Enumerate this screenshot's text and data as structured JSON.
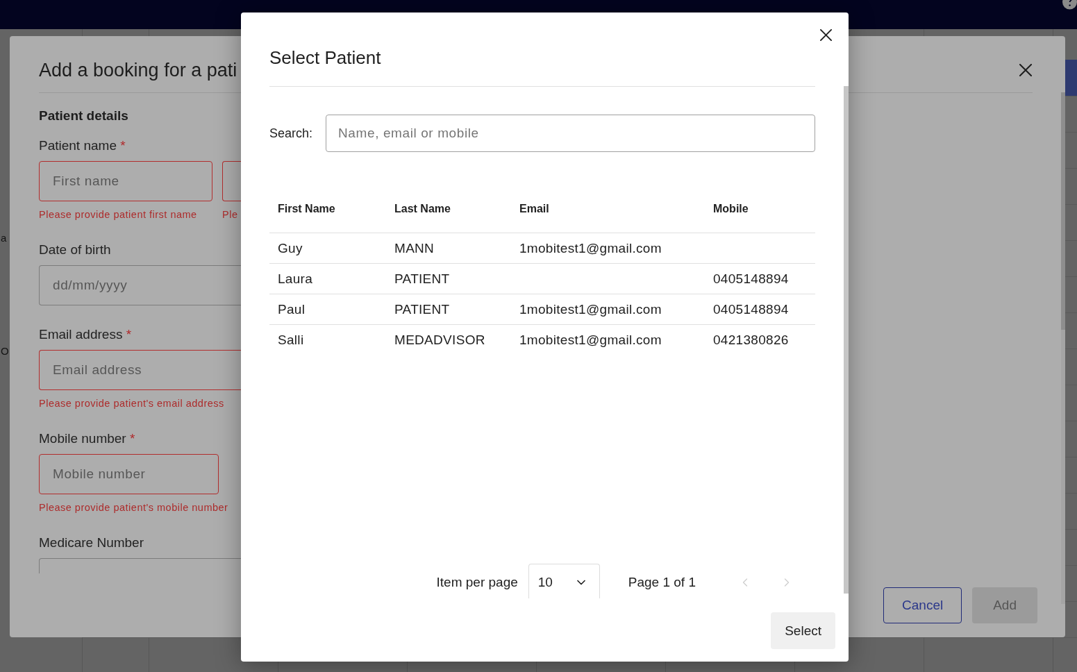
{
  "page_behind": {
    "texts": [
      "a",
      "O"
    ]
  },
  "booking_dialog": {
    "title": "Add a booking for a pati",
    "section": "Patient details",
    "fields": [
      {
        "kind": "name",
        "label": "Patient name",
        "required_mark": "*",
        "inputs": [
          {
            "placeholder": "First name",
            "invalid": true,
            "error": "Please provide patient first name"
          },
          {
            "invalid": true,
            "error": "Ple"
          }
        ]
      },
      {
        "kind": "date",
        "label": "Date of birth",
        "inputs": [
          {
            "placeholder": "dd/mm/yyyy",
            "invalid": false
          }
        ]
      },
      {
        "kind": "email",
        "label": "Email address",
        "required_mark": "*",
        "inputs": [
          {
            "placeholder": "Email address",
            "invalid": true,
            "error": "Please provide patient's email address"
          }
        ]
      },
      {
        "kind": "mobile",
        "label": "Mobile number",
        "required_mark": "*",
        "inputs": [
          {
            "placeholder": "Mobile number",
            "invalid": true,
            "error": "Please provide patient's mobile number"
          }
        ]
      },
      {
        "kind": "medicare",
        "label": "Medicare Number",
        "inputs": [
          {
            "invalid": false
          }
        ]
      }
    ],
    "buttons": [
      {
        "kind": "outlined",
        "label": "Cancel",
        "disabled": false
      },
      {
        "kind": "filled",
        "label": "Add",
        "disabled": true
      }
    ]
  },
  "select_patient_dialog": {
    "title": "Select Patient",
    "search": {
      "label": "Search:",
      "placeholder": "Name, email or mobile"
    },
    "table": {
      "columns": [
        "First Name",
        "Last Name",
        "Email",
        "Mobile"
      ],
      "rows": [
        {
          "first_name": "Guy",
          "last_name": "MANN",
          "email": "1mobitest1@gmail.com",
          "selected": false
        },
        {
          "first_name": "Laura",
          "last_name": "PATIENT",
          "mobile": "0405148894",
          "selected": false
        },
        {
          "first_name": "Paul",
          "last_name": "PATIENT",
          "email": "1mobitest1@gmail.com",
          "mobile": "0405148894",
          "selected": false
        },
        {
          "first_name": "Salli",
          "last_name": "MEDADVISOR",
          "email": "1mobitest1@gmail.com",
          "mobile": "0421380826",
          "selected": false
        }
      ]
    },
    "pagination": {
      "label": "Item per page",
      "page_size": "10",
      "page_info": "Page 1 of 1",
      "prev": {
        "disabled": true
      },
      "next": {
        "disabled": true
      }
    },
    "buttons": [
      {
        "label": "Select"
      }
    ]
  }
}
